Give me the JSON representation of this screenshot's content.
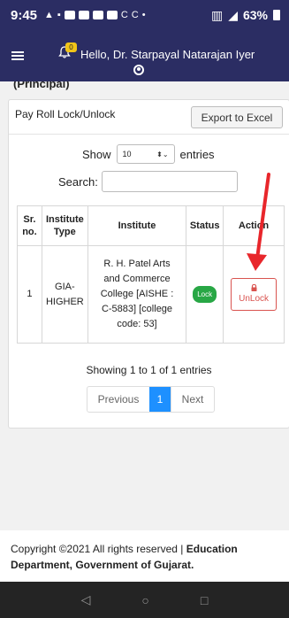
{
  "status_bar": {
    "time": "9:45",
    "battery": "63%"
  },
  "header": {
    "greeting": "Hello, Dr. Starpayal Natarajan Iyer",
    "notification_badge": "0"
  },
  "breadcrumb": "(Principal)",
  "card": {
    "title": "Pay Roll Lock/Unlock",
    "export_label": "Export to Excel",
    "show_label": "Show",
    "entries_value": "10",
    "entries_label": "entries",
    "search_label": "Search:"
  },
  "table": {
    "headers": {
      "sr_line1": "Sr.",
      "sr_line2": "no.",
      "type_line1": "Institute",
      "type_line2": "Type",
      "institute": "Institute",
      "status": "Status",
      "action": "Action"
    },
    "rows": [
      {
        "sr": "1",
        "type_line1": "GIA-",
        "type_line2": "HIGHER",
        "institute_lines": [
          "R. H. Patel Arts",
          "and Commerce",
          "College [AISHE :",
          "C-5883] [college",
          "code: 53]"
        ],
        "status": "Lock",
        "action": "UnLock"
      }
    ]
  },
  "pagination": {
    "info": "Showing 1 to 1 of 1 entries",
    "previous": "Previous",
    "current": "1",
    "next": "Next"
  },
  "footer": {
    "text": "Copyright ©2021 All rights reserved | ",
    "dept_line1": "Education",
    "dept_line2": "Department, Government of Gujarat."
  },
  "colors": {
    "header_bg": "#2b2d63",
    "lock_green": "#28a745",
    "unlock_red": "#d9534f",
    "page_active": "#1e90ff",
    "arrow_red": "#e8262b"
  }
}
